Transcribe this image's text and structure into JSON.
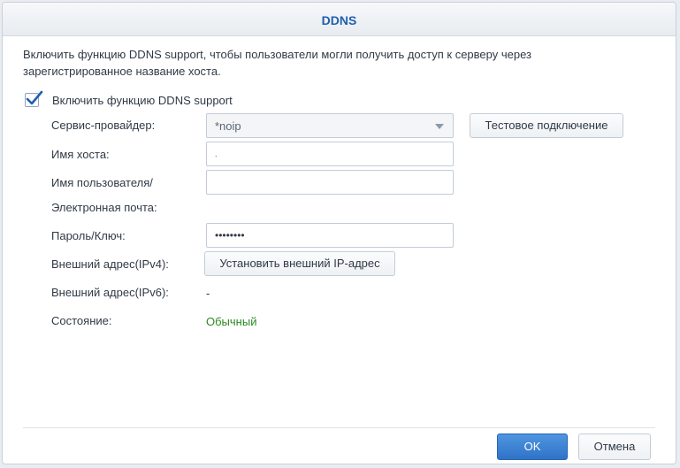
{
  "dialog": {
    "title": "DDNS",
    "description": "Включить функцию DDNS support, чтобы пользователи могли получить доступ к серверу через зарегистрированное название хоста."
  },
  "enable": {
    "label": "Включить функцию DDNS support",
    "checked": true
  },
  "form": {
    "provider_label": "Сервис-провайдер:",
    "provider_value": "*noip",
    "test_button": "Тестовое подключение",
    "hostname_label": "Имя хоста:",
    "hostname_value": ".",
    "username_label_line1": "Имя пользователя/",
    "username_label_line2": "Электронная почта:",
    "username_value": "",
    "password_label": "Пароль/Ключ:",
    "password_value": "••••••••",
    "ipv4_label": "Внешний адрес(IPv4):",
    "ipv4_button": "Установить внешний IP-адрес",
    "ipv6_label": "Внешний адрес(IPv6):",
    "ipv6_value": "-",
    "status_label": "Состояние:",
    "status_value": "Обычный"
  },
  "footer": {
    "ok_label": "OK",
    "cancel_label": "Отмена"
  },
  "colors": {
    "title": "#1f5fae",
    "status_ok": "#2b8a20",
    "primary_button": "#2f73c8"
  }
}
